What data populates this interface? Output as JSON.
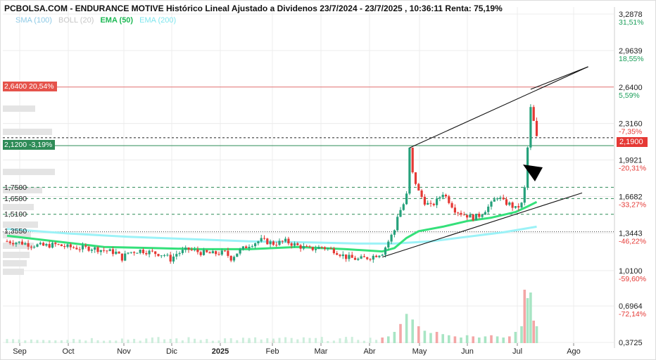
{
  "title": "PCBOLSA.COM - ENDURANCE MOTIVE Histórico Lineal Ajustado a Dividenos 23/7/2024 - 23/7/2025 , 10:36:11 Renta: 75,19%",
  "legend": [
    {
      "label": "SMA (100)",
      "color": "#8ecae6"
    },
    {
      "label": "BOLL (20)",
      "color": "#cfcfcf"
    },
    {
      "label": "EMA (50)",
      "color": "#2ecc71"
    },
    {
      "label": "EMA (200)",
      "color": "#8ef0f0"
    }
  ],
  "colors": {
    "up": "#26a17b",
    "down": "#e53935",
    "ema50": "#34e07a",
    "ema200": "#9cf2f7",
    "resistance": "#e57373",
    "support": "#2e8b57"
  },
  "level_tags": {
    "resistance": {
      "text": "2,6400  20,54%",
      "value": 2.64
    },
    "support": {
      "text": "2,1200  -3,19%",
      "value": 2.12
    }
  },
  "horizontal_levels": [
    {
      "text": "1,7500",
      "value": 1.75
    },
    {
      "text": "1,6500",
      "value": 1.65
    },
    {
      "text": "1,5100",
      "value": 1.51
    },
    {
      "text": "1,3550",
      "value": 1.355
    }
  ],
  "last_price": {
    "text": "2,1900",
    "value": 2.19
  },
  "chart_data": {
    "type": "candlestick",
    "title": "PCBOLSA.COM - ENDURANCE MOTIVE Histórico Lineal Ajustado a Dividenos 23/7/2024 - 23/7/2025 , 10:36:11 Renta: 75,19%",
    "x_ticks": [
      "Sep",
      "Oct",
      "Nov",
      "Dic",
      "2025",
      "Feb",
      "Mar",
      "Abr",
      "May",
      "Jun",
      "Jul",
      "Ago"
    ],
    "y_ticks": [
      {
        "value": 3.2878,
        "label": "3,2878",
        "pct": "31,51%"
      },
      {
        "value": 2.9639,
        "label": "2,9639",
        "pct": "18,55%"
      },
      {
        "value": 2.64,
        "label": "2,6400",
        "pct": "5,59%"
      },
      {
        "value": 2.316,
        "label": "2,3160",
        "pct": "-7,35%"
      },
      {
        "value": 1.9921,
        "label": "1,9921",
        "pct": "-20,31%"
      },
      {
        "value": 1.6682,
        "label": "1,6682",
        "pct": "-33,27%"
      },
      {
        "value": 1.3443,
        "label": "1,3443",
        "pct": "-46,22%"
      },
      {
        "value": 1.01,
        "label": "1,0100",
        "pct": "-59,60%"
      },
      {
        "value": 0.6964,
        "label": "0,6964",
        "pct": "-72,14%"
      },
      {
        "value": 0.3725,
        "label": "0,3725",
        "pct": ""
      }
    ],
    "ylim": [
      0.3725,
      3.2878
    ],
    "price_path": [
      [
        0,
        1.27
      ],
      [
        2,
        1.26
      ],
      [
        4,
        1.24
      ],
      [
        6,
        1.23
      ],
      [
        8,
        1.24
      ],
      [
        10,
        1.22
      ],
      [
        12,
        1.21
      ],
      [
        14,
        1.21
      ],
      [
        16,
        1.19
      ],
      [
        18,
        1.17
      ],
      [
        19,
        1.12
      ],
      [
        20,
        1.17
      ],
      [
        22,
        1.19
      ],
      [
        24,
        1.17
      ],
      [
        26,
        1.15
      ],
      [
        27,
        1.11
      ],
      [
        28,
        1.16
      ],
      [
        30,
        1.2
      ],
      [
        32,
        1.17
      ],
      [
        34,
        1.16
      ],
      [
        36,
        1.17
      ],
      [
        37,
        1.12
      ],
      [
        38,
        1.17
      ],
      [
        40,
        1.24
      ],
      [
        42,
        1.28
      ],
      [
        44,
        1.25
      ],
      [
        46,
        1.27
      ],
      [
        48,
        1.23
      ],
      [
        50,
        1.2
      ],
      [
        52,
        1.22
      ],
      [
        54,
        1.19
      ],
      [
        56,
        1.13
      ],
      [
        58,
        1.11
      ],
      [
        60,
        1.13
      ],
      [
        62,
        1.17
      ],
      [
        63,
        1.27
      ],
      [
        64,
        1.37
      ],
      [
        64.5,
        1.5
      ],
      [
        65.5,
        1.6
      ],
      [
        66,
        1.68
      ],
      [
        66.5,
        2.09
      ],
      [
        67,
        1.87
      ],
      [
        68,
        1.71
      ],
      [
        69,
        1.62
      ],
      [
        70,
        1.58
      ],
      [
        71,
        1.63
      ],
      [
        72,
        1.7
      ],
      [
        73,
        1.63
      ],
      [
        74,
        1.55
      ],
      [
        75,
        1.52
      ],
      [
        76,
        1.5
      ],
      [
        77,
        1.48
      ],
      [
        78,
        1.5
      ],
      [
        79,
        1.55
      ],
      [
        80,
        1.6
      ],
      [
        81,
        1.67
      ],
      [
        82,
        1.62
      ],
      [
        83,
        1.6
      ],
      [
        84,
        1.56
      ],
      [
        85,
        1.6
      ],
      [
        85.5,
        1.74
      ],
      [
        86,
        2.1
      ],
      [
        86.5,
        2.45
      ],
      [
        87,
        2.33
      ],
      [
        87.5,
        2.19
      ]
    ],
    "candles_sample": [
      {
        "date": "May",
        "open": 1.68,
        "high": 2.09,
        "low": 1.62,
        "close": 2.05
      },
      {
        "date": "Jul",
        "open": 2.12,
        "high": 2.6,
        "low": 1.7,
        "close": 2.45
      },
      {
        "date": "Jul",
        "open": 2.33,
        "high": 2.35,
        "low": 2.12,
        "close": 2.19
      }
    ],
    "series": [
      {
        "name": "EMA (50)",
        "values": [
          [
            0,
            1.32
          ],
          [
            8,
            1.27
          ],
          [
            16,
            1.22
          ],
          [
            24,
            1.21
          ],
          [
            32,
            1.2
          ],
          [
            40,
            1.2
          ],
          [
            48,
            1.22
          ],
          [
            56,
            1.2
          ],
          [
            62,
            1.18
          ],
          [
            64,
            1.21
          ],
          [
            66,
            1.3
          ],
          [
            68,
            1.36
          ],
          [
            72,
            1.4
          ],
          [
            76,
            1.45
          ],
          [
            80,
            1.48
          ],
          [
            84,
            1.53
          ],
          [
            86,
            1.58
          ],
          [
            87.5,
            1.62
          ]
        ]
      },
      {
        "name": "EMA (200)",
        "values": [
          [
            0,
            1.38
          ],
          [
            10,
            1.34
          ],
          [
            20,
            1.31
          ],
          [
            30,
            1.29
          ],
          [
            40,
            1.27
          ],
          [
            50,
            1.26
          ],
          [
            58,
            1.25
          ],
          [
            64,
            1.25
          ],
          [
            70,
            1.27
          ],
          [
            76,
            1.31
          ],
          [
            82,
            1.35
          ],
          [
            87.5,
            1.4
          ]
        ]
      }
    ],
    "volume": [
      [
        62,
        0.1
      ],
      [
        63,
        0.12
      ],
      [
        64,
        0.2
      ],
      [
        65,
        0.34
      ],
      [
        66,
        0.52
      ],
      [
        67,
        0.42
      ],
      [
        68,
        0.3
      ],
      [
        69,
        0.22
      ],
      [
        70,
        0.18
      ],
      [
        71,
        0.2
      ],
      [
        72,
        0.16
      ],
      [
        73,
        0.14
      ],
      [
        74,
        0.12
      ],
      [
        75,
        0.1
      ],
      [
        76,
        0.14
      ],
      [
        77,
        0.12
      ],
      [
        78,
        0.1
      ],
      [
        79,
        0.12
      ],
      [
        80,
        0.14
      ],
      [
        81,
        0.12
      ],
      [
        82,
        0.1
      ],
      [
        83,
        0.12
      ],
      [
        84,
        0.2
      ],
      [
        85,
        0.3
      ],
      [
        85.5,
        0.95
      ],
      [
        86,
        0.8
      ],
      [
        86.5,
        0.9
      ],
      [
        87,
        0.4
      ],
      [
        87.5,
        0.3
      ],
      [
        40,
        0.06
      ],
      [
        44,
        0.05
      ],
      [
        52,
        0.05
      ],
      [
        56,
        0.06
      ]
    ],
    "trend_lines": [
      {
        "name": "channel-upper",
        "from": [
          66.5,
          2.1
        ],
        "to": [
          96,
          2.82
        ]
      },
      {
        "name": "channel-lower",
        "from": [
          62,
          1.13
        ],
        "to": [
          95,
          1.7
        ]
      },
      {
        "name": "peak-cap",
        "from": [
          86.5,
          2.62
        ],
        "to": [
          96,
          2.82
        ]
      }
    ]
  }
}
